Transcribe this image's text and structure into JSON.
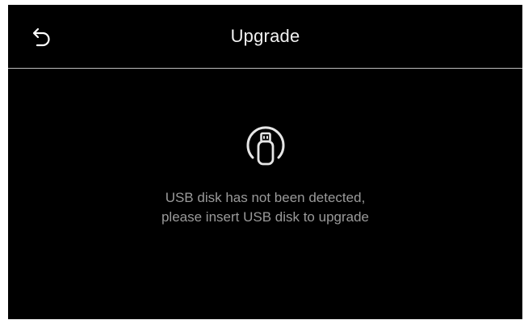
{
  "header": {
    "back_icon": "back-arrow-icon",
    "title": "Upgrade"
  },
  "content": {
    "icon": "usb-disk-icon",
    "message_line1": "USB disk has not been detected,",
    "message_line2": "please insert USB disk to upgrade"
  },
  "colors": {
    "background": "#000000",
    "title_text": "#f2f2f2",
    "message_text": "#9a9a9a",
    "divider": "#bdbdbd"
  }
}
